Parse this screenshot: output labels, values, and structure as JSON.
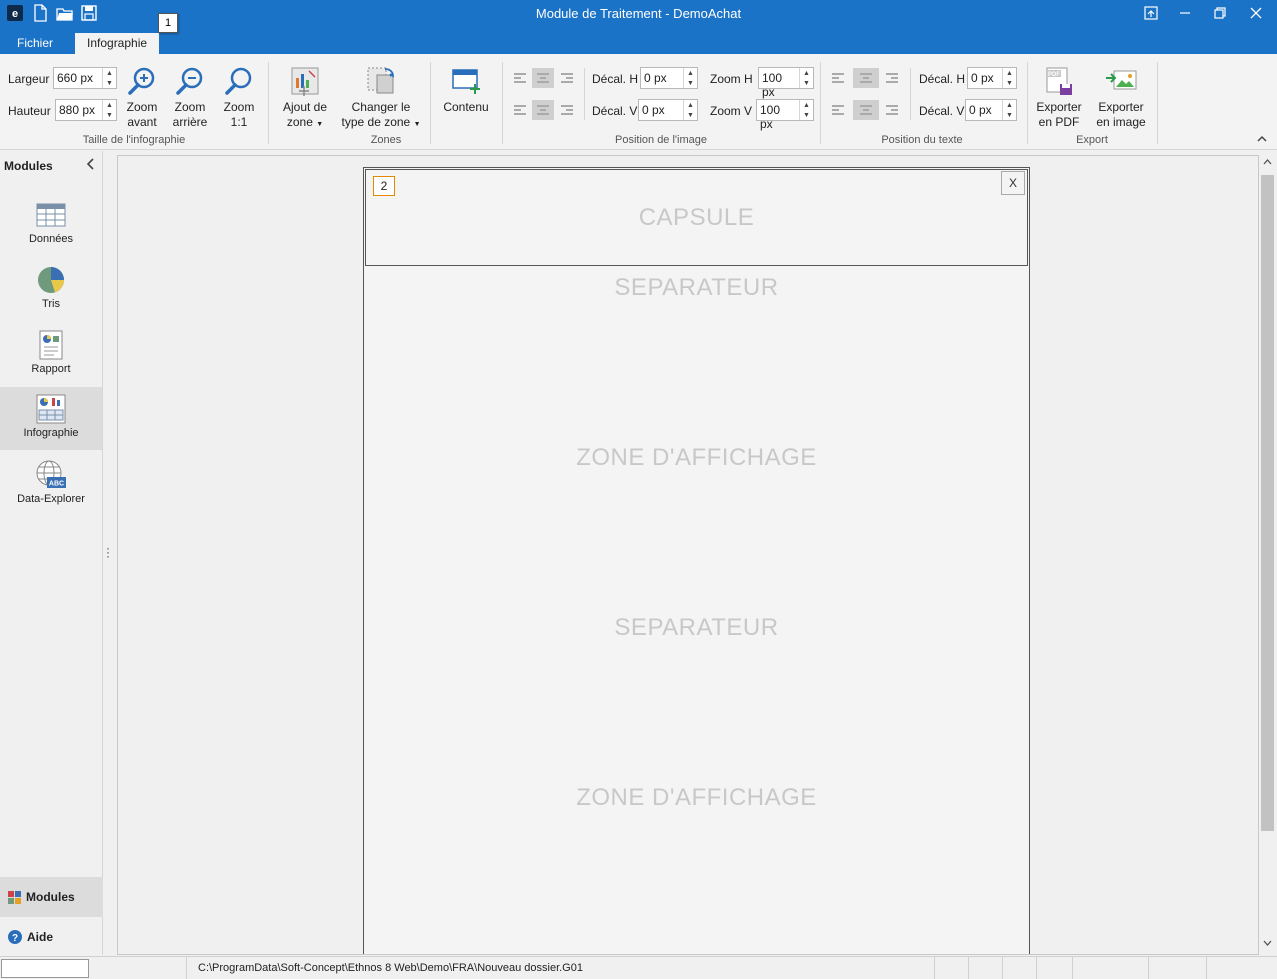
{
  "window": {
    "title": "Module de Traitement - DemoAchat"
  },
  "menu": {
    "tabs": [
      {
        "label": "Fichier"
      },
      {
        "label": "Infographie"
      }
    ],
    "keytip": "1"
  },
  "ribbon": {
    "taille": {
      "largeur_label": "Largeur",
      "largeur_value": "660 px",
      "hauteur_label": "Hauteur",
      "hauteur_value": "880 px",
      "zoom_avant": "Zoom\navant",
      "zoom_arriere": "Zoom\narrière",
      "zoom_1": "Zoom\n1:1",
      "group": "Taille de l'infographie"
    },
    "zones": {
      "ajout_l1": "Ajout de",
      "ajout_l2": "zone",
      "changer_l1": "Changer le",
      "changer_l2": "type de zone",
      "contenu": "Contenu",
      "group": "Zones"
    },
    "position_image": {
      "decal_h_label": "Décal. H",
      "decal_h_value": "0 px",
      "decal_v_label": "Décal. V",
      "decal_v_value": "0 px",
      "zoom_h_label": "Zoom H",
      "zoom_h_value": "100 px",
      "zoom_v_label": "Zoom V",
      "zoom_v_value": "100 px",
      "group": "Position de l'image"
    },
    "position_texte": {
      "decal_h_label": "Décal. H",
      "decal_h_value": "0 px",
      "decal_v_label": "Décal. V",
      "decal_v_value": "0 px",
      "group": "Position du texte"
    },
    "export": {
      "pdf_l1": "Exporter",
      "pdf_l2": "en PDF",
      "img_l1": "Exporter",
      "img_l2": "en image",
      "group": "Export",
      "pdf_badge": "PDF"
    }
  },
  "sidebar": {
    "header": "Modules",
    "items": [
      {
        "label": "Données"
      },
      {
        "label": "Tris"
      },
      {
        "label": "Rapport"
      },
      {
        "label": "Infographie"
      },
      {
        "label": "Data-Explorer"
      }
    ],
    "bottom_modules": "Modules",
    "bottom_aide": "Aide",
    "abc": "ABC"
  },
  "canvas": {
    "capsule_number": "2",
    "close_label": "X",
    "zones": [
      {
        "label": "CAPSULE"
      },
      {
        "label": "SEPARATEUR"
      },
      {
        "label": "ZONE D'AFFICHAGE"
      },
      {
        "label": "SEPARATEUR"
      },
      {
        "label": "ZONE D'AFFICHAGE"
      }
    ]
  },
  "statusbar": {
    "path": "C:\\ProgramData\\Soft-Concept\\Ethnos 8 Web\\Demo\\FRA\\Nouveau dossier.G01"
  },
  "colors": {
    "accent": "#1b73c7",
    "highlight": "#e08a00"
  }
}
